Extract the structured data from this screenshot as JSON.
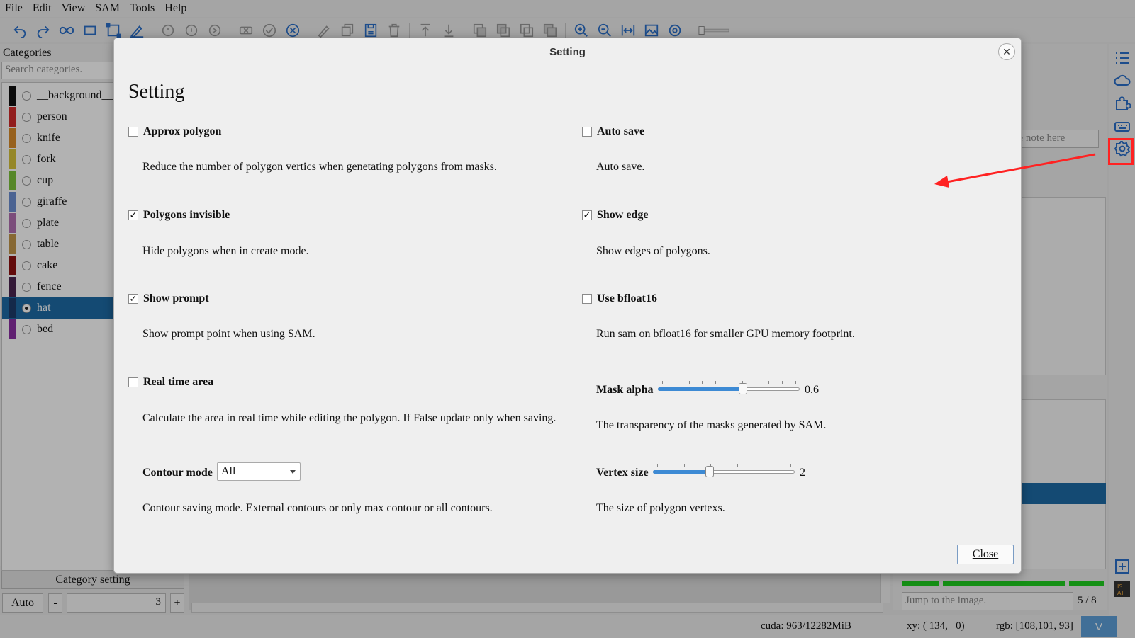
{
  "menu": [
    "File",
    "Edit",
    "View",
    "SAM",
    "Tools",
    "Help"
  ],
  "toolbar_icons": [
    "undo-icon",
    "redo-icon",
    "sam-icon",
    "rectangle-icon",
    "polygon-icon",
    "brush-icon",
    "rotate-icon",
    "rotate-reverse-icon",
    "repeat-icon",
    "clear-icon",
    "finish-icon",
    "cancel-icon",
    "edit-icon",
    "copy-icon",
    "save-icon",
    "delete-icon",
    "move-top-icon",
    "move-bottom-icon",
    "layer-icon-1",
    "layer-icon-2",
    "layer-icon-3",
    "layer-icon-4",
    "zoom-in-icon",
    "zoom-out-icon",
    "fit-width-icon",
    "image-icon",
    "eye-icon"
  ],
  "categories_panel": {
    "title": "Categories",
    "search_placeholder": "Search categories.",
    "items": [
      {
        "label": "__background__",
        "color": "#111111",
        "selected": false
      },
      {
        "label": "person",
        "color": "#d12b2b",
        "selected": false
      },
      {
        "label": "knife",
        "color": "#d98b2a",
        "selected": false
      },
      {
        "label": "fork",
        "color": "#d6c23a",
        "selected": false
      },
      {
        "label": "cup",
        "color": "#7bc23a",
        "selected": false
      },
      {
        "label": "giraffe",
        "color": "#6c8fd1",
        "selected": false
      },
      {
        "label": "plate",
        "color": "#b06fb0",
        "selected": false
      },
      {
        "label": "table",
        "color": "#c2964a",
        "selected": false
      },
      {
        "label": "cake",
        "color": "#8e1111",
        "selected": false
      },
      {
        "label": "fence",
        "color": "#4b2450",
        "selected": false
      },
      {
        "label": "hat",
        "color": "#1d3b6b",
        "selected": true
      },
      {
        "label": "bed",
        "color": "#8a2fa3",
        "selected": false
      }
    ],
    "category_setting": "Category setting",
    "auto_label": "Auto",
    "minus_label": "-",
    "plus_label": "+",
    "count_value": "3"
  },
  "right_panel": {
    "note_placeholder": "ge note here",
    "jump_placeholder": "Jump to the image.",
    "page_count": "5 / 8"
  },
  "status": {
    "cuda": "cuda: 963/12282MiB",
    "xy": "xy: ( 134,   0)",
    "rgb": "rgb: [108,101, 93]",
    "v_label": "V"
  },
  "dialog": {
    "window_title": "Setting",
    "heading": "Setting",
    "close_x": "✕",
    "close_button": "Close",
    "options": {
      "approx_polygon": {
        "label": "Approx polygon",
        "checked": false,
        "desc": "Reduce the number of polygon vertics when genetating polygons from masks."
      },
      "auto_save": {
        "label": "Auto save",
        "checked": false,
        "desc": "Auto save."
      },
      "polygons_invisible": {
        "label": "Polygons invisible",
        "checked": true,
        "desc": "Hide polygons when in create mode."
      },
      "show_edge": {
        "label": "Show edge",
        "checked": true,
        "desc": "Show edges of polygons."
      },
      "show_prompt": {
        "label": "Show prompt",
        "checked": true,
        "desc": "Show prompt point when using SAM."
      },
      "use_bfloat16": {
        "label": "Use bfloat16",
        "checked": false,
        "desc": "Run sam on bfloat16 for smaller GPU memory footprint."
      },
      "real_time_area": {
        "label": "Real time area",
        "checked": false,
        "desc": "Calculate the area in real time while editing the polygon. If False update only when saving."
      },
      "mask_alpha": {
        "label": "Mask alpha",
        "value": "0.6",
        "fraction": 0.6,
        "desc": "The transparency of the masks generated by SAM."
      },
      "contour_mode": {
        "label": "Contour mode",
        "value": "All",
        "desc": "Contour saving mode. External contours or only max contour or all contours."
      },
      "vertex_size": {
        "label": "Vertex size",
        "value": "2",
        "fraction": 0.4,
        "desc": "The size of polygon vertexs."
      }
    }
  },
  "colors": {
    "accent": "#1d6aa5",
    "slider_fill": "#3d8ad4",
    "annotation_red": "#ff2222",
    "progress_green": "#1fcf1f"
  }
}
